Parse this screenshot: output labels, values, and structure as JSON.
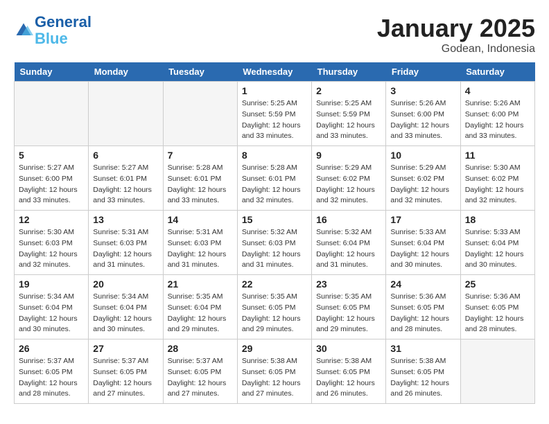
{
  "header": {
    "logo_line1": "General",
    "logo_line2": "Blue",
    "title": "January 2025",
    "subtitle": "Godean, Indonesia"
  },
  "weekdays": [
    "Sunday",
    "Monday",
    "Tuesday",
    "Wednesday",
    "Thursday",
    "Friday",
    "Saturday"
  ],
  "weeks": [
    [
      {
        "day": "",
        "info": ""
      },
      {
        "day": "",
        "info": ""
      },
      {
        "day": "",
        "info": ""
      },
      {
        "day": "1",
        "info": "Sunrise: 5:25 AM\nSunset: 5:59 PM\nDaylight: 12 hours\nand 33 minutes."
      },
      {
        "day": "2",
        "info": "Sunrise: 5:25 AM\nSunset: 5:59 PM\nDaylight: 12 hours\nand 33 minutes."
      },
      {
        "day": "3",
        "info": "Sunrise: 5:26 AM\nSunset: 6:00 PM\nDaylight: 12 hours\nand 33 minutes."
      },
      {
        "day": "4",
        "info": "Sunrise: 5:26 AM\nSunset: 6:00 PM\nDaylight: 12 hours\nand 33 minutes."
      }
    ],
    [
      {
        "day": "5",
        "info": "Sunrise: 5:27 AM\nSunset: 6:00 PM\nDaylight: 12 hours\nand 33 minutes."
      },
      {
        "day": "6",
        "info": "Sunrise: 5:27 AM\nSunset: 6:01 PM\nDaylight: 12 hours\nand 33 minutes."
      },
      {
        "day": "7",
        "info": "Sunrise: 5:28 AM\nSunset: 6:01 PM\nDaylight: 12 hours\nand 33 minutes."
      },
      {
        "day": "8",
        "info": "Sunrise: 5:28 AM\nSunset: 6:01 PM\nDaylight: 12 hours\nand 32 minutes."
      },
      {
        "day": "9",
        "info": "Sunrise: 5:29 AM\nSunset: 6:02 PM\nDaylight: 12 hours\nand 32 minutes."
      },
      {
        "day": "10",
        "info": "Sunrise: 5:29 AM\nSunset: 6:02 PM\nDaylight: 12 hours\nand 32 minutes."
      },
      {
        "day": "11",
        "info": "Sunrise: 5:30 AM\nSunset: 6:02 PM\nDaylight: 12 hours\nand 32 minutes."
      }
    ],
    [
      {
        "day": "12",
        "info": "Sunrise: 5:30 AM\nSunset: 6:03 PM\nDaylight: 12 hours\nand 32 minutes."
      },
      {
        "day": "13",
        "info": "Sunrise: 5:31 AM\nSunset: 6:03 PM\nDaylight: 12 hours\nand 31 minutes."
      },
      {
        "day": "14",
        "info": "Sunrise: 5:31 AM\nSunset: 6:03 PM\nDaylight: 12 hours\nand 31 minutes."
      },
      {
        "day": "15",
        "info": "Sunrise: 5:32 AM\nSunset: 6:03 PM\nDaylight: 12 hours\nand 31 minutes."
      },
      {
        "day": "16",
        "info": "Sunrise: 5:32 AM\nSunset: 6:04 PM\nDaylight: 12 hours\nand 31 minutes."
      },
      {
        "day": "17",
        "info": "Sunrise: 5:33 AM\nSunset: 6:04 PM\nDaylight: 12 hours\nand 30 minutes."
      },
      {
        "day": "18",
        "info": "Sunrise: 5:33 AM\nSunset: 6:04 PM\nDaylight: 12 hours\nand 30 minutes."
      }
    ],
    [
      {
        "day": "19",
        "info": "Sunrise: 5:34 AM\nSunset: 6:04 PM\nDaylight: 12 hours\nand 30 minutes."
      },
      {
        "day": "20",
        "info": "Sunrise: 5:34 AM\nSunset: 6:04 PM\nDaylight: 12 hours\nand 30 minutes."
      },
      {
        "day": "21",
        "info": "Sunrise: 5:35 AM\nSunset: 6:04 PM\nDaylight: 12 hours\nand 29 minutes."
      },
      {
        "day": "22",
        "info": "Sunrise: 5:35 AM\nSunset: 6:05 PM\nDaylight: 12 hours\nand 29 minutes."
      },
      {
        "day": "23",
        "info": "Sunrise: 5:35 AM\nSunset: 6:05 PM\nDaylight: 12 hours\nand 29 minutes."
      },
      {
        "day": "24",
        "info": "Sunrise: 5:36 AM\nSunset: 6:05 PM\nDaylight: 12 hours\nand 28 minutes."
      },
      {
        "day": "25",
        "info": "Sunrise: 5:36 AM\nSunset: 6:05 PM\nDaylight: 12 hours\nand 28 minutes."
      }
    ],
    [
      {
        "day": "26",
        "info": "Sunrise: 5:37 AM\nSunset: 6:05 PM\nDaylight: 12 hours\nand 28 minutes."
      },
      {
        "day": "27",
        "info": "Sunrise: 5:37 AM\nSunset: 6:05 PM\nDaylight: 12 hours\nand 27 minutes."
      },
      {
        "day": "28",
        "info": "Sunrise: 5:37 AM\nSunset: 6:05 PM\nDaylight: 12 hours\nand 27 minutes."
      },
      {
        "day": "29",
        "info": "Sunrise: 5:38 AM\nSunset: 6:05 PM\nDaylight: 12 hours\nand 27 minutes."
      },
      {
        "day": "30",
        "info": "Sunrise: 5:38 AM\nSunset: 6:05 PM\nDaylight: 12 hours\nand 26 minutes."
      },
      {
        "day": "31",
        "info": "Sunrise: 5:38 AM\nSunset: 6:05 PM\nDaylight: 12 hours\nand 26 minutes."
      },
      {
        "day": "",
        "info": ""
      }
    ]
  ]
}
